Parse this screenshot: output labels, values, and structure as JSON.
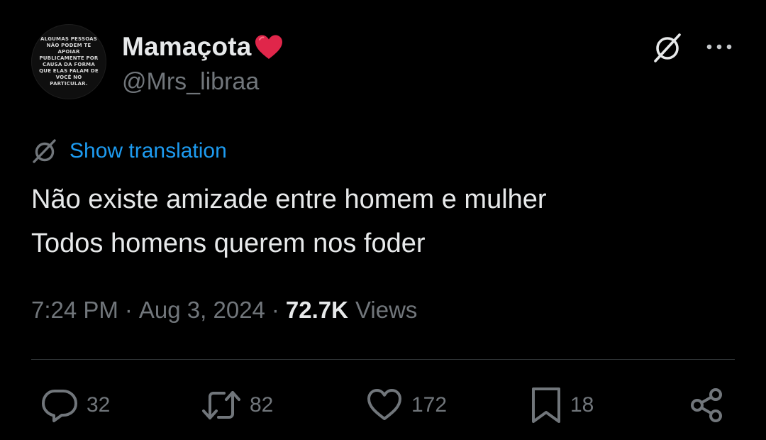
{
  "author": {
    "display_name": "Mamaçota",
    "display_name_emoji": "red-heart-emoji",
    "handle": "@Mrs_libraa",
    "avatar_text": [
      "ALGUMAS PESSOAS",
      "NÃO PODEM TE",
      "APOIAR",
      "PUBLICAMENTE POR",
      "CAUSA DA FORMA",
      "QUE ELAS FALAM DE",
      "VOCÊ NO",
      "PARTICULAR."
    ]
  },
  "header_actions": {
    "grok_icon": "grok-icon",
    "more_icon": "more-dots-icon"
  },
  "translation": {
    "icon": "grok-icon",
    "label": "Show translation"
  },
  "tweet": {
    "lines": [
      "Não existe amizade entre homem e mulher",
      "Todos homens querem nos foder"
    ]
  },
  "meta": {
    "time": "7:24 PM",
    "separator": "·",
    "date": "Aug 3, 2024",
    "views_count": "72.7K",
    "views_label": "Views"
  },
  "actions": {
    "reply": {
      "icon": "reply-icon",
      "count": "32"
    },
    "retweet": {
      "icon": "retweet-icon",
      "count": "82"
    },
    "like": {
      "icon": "heart-icon",
      "count": "172"
    },
    "bookmark": {
      "icon": "bookmark-icon",
      "count": "18"
    },
    "share": {
      "icon": "share-icon"
    }
  },
  "colors": {
    "background": "#000000",
    "text_primary": "#e7e9ea",
    "text_secondary": "#71767b",
    "link": "#1d9bf0",
    "divider": "#2f3336",
    "heart_emoji": "#e0264a"
  }
}
